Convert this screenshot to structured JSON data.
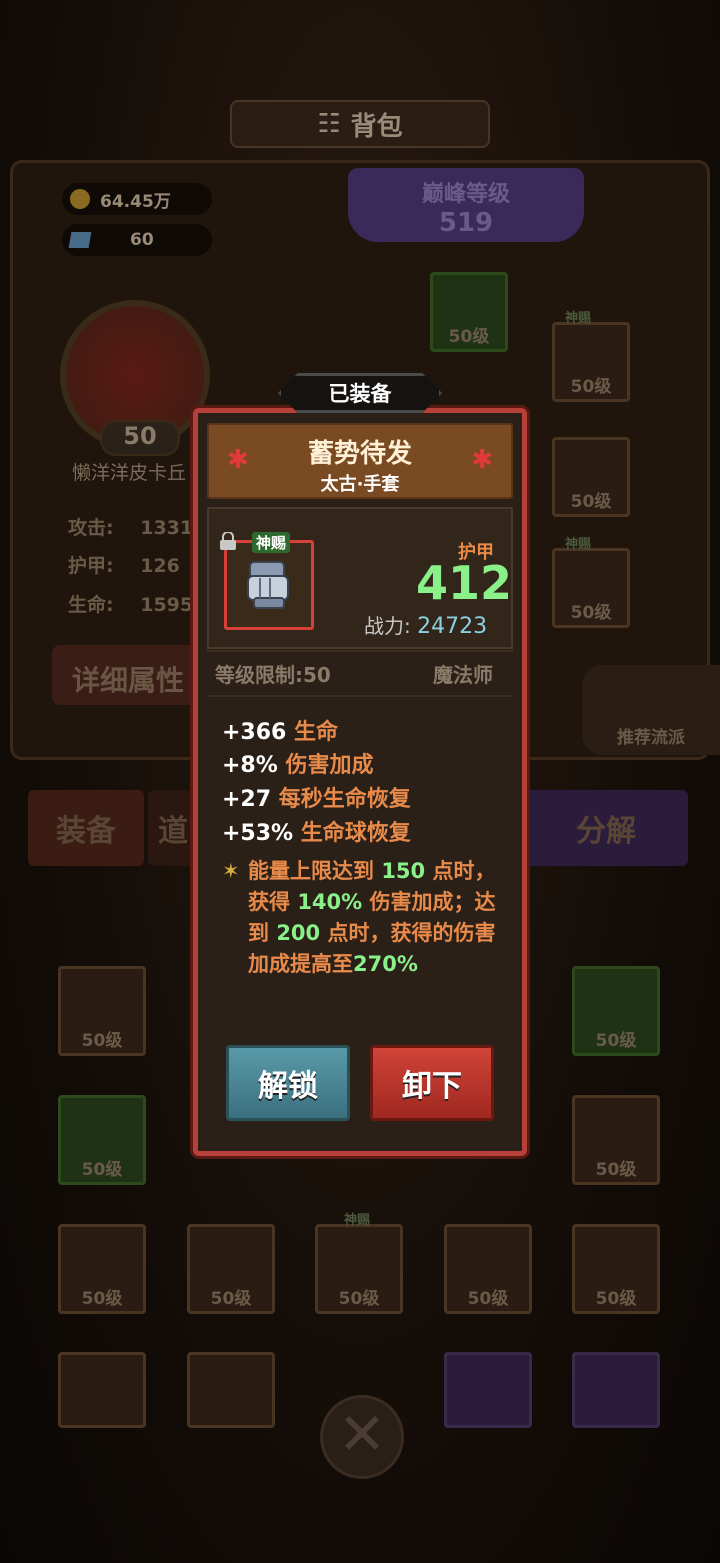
{
  "background": {
    "title": "背包",
    "resources": {
      "gold": "64.45万",
      "gems": "60"
    },
    "peak": {
      "label": "巅峰等级",
      "level": "519"
    },
    "character": {
      "level": "50",
      "name": "懒洋洋皮卡丘"
    },
    "stats": [
      {
        "label": "攻击:",
        "value": "1331"
      },
      {
        "label": "护甲:",
        "value": "126"
      },
      {
        "label": "生命:",
        "value": "1595"
      }
    ],
    "detail_button": "详细属性",
    "recommend_button": "推荐流派",
    "tabs": {
      "equipment": "装备",
      "items": "道",
      "decompose": "分解"
    },
    "slot_level": "50级",
    "blessed_tag": "神赐"
  },
  "modal": {
    "equipped_label": "已装备",
    "item_name": "蓄势待发",
    "item_subtitle": "太古·手套",
    "blessed_tag": "神赐",
    "armor_label": "护甲",
    "armor_value": "412",
    "power_label": "战力:",
    "power_value": "24723",
    "level_req": "等级限制:50",
    "class": "魔法师",
    "bonuses": [
      {
        "num": "+366",
        "desc": "生命"
      },
      {
        "num": "+8%",
        "desc": "伤害加成"
      },
      {
        "num": "+27",
        "desc": "每秒生命恢复"
      },
      {
        "num": "+53%",
        "desc": "生命球恢复"
      }
    ],
    "effect": {
      "p1": "能量上限达到 ",
      "v1": "150",
      "p2": " 点时，获得 ",
      "v2": "140%",
      "p3": " 伤害加成；达到 ",
      "v3": "200",
      "p4": " 点时，获得的伤害加成提高至",
      "v4": "270%"
    },
    "unlock_button": "解锁",
    "unequip_button": "卸下"
  }
}
